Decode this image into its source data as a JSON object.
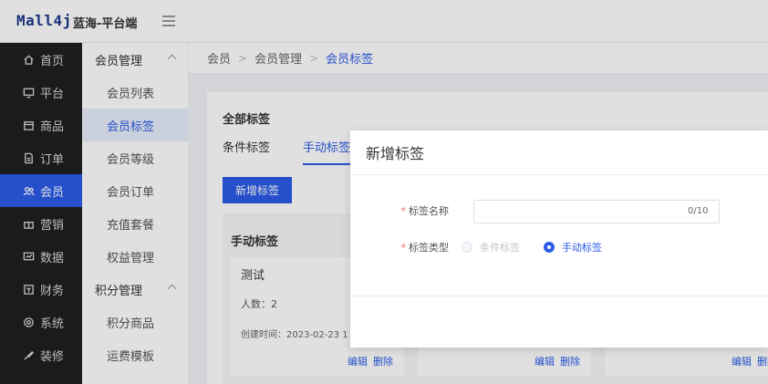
{
  "header": {
    "logo": "Mall4j",
    "brand": "蓝海-平台端"
  },
  "sidebar": {
    "items": [
      {
        "label": "首页",
        "icon": "home-icon"
      },
      {
        "label": "平台",
        "icon": "monitor-icon"
      },
      {
        "label": "商品",
        "icon": "box-icon"
      },
      {
        "label": "订单",
        "icon": "document-icon"
      },
      {
        "label": "会员",
        "icon": "users-icon"
      },
      {
        "label": "营销",
        "icon": "gift-icon"
      },
      {
        "label": "数据",
        "icon": "chart-icon"
      },
      {
        "label": "财务",
        "icon": "wallet-icon"
      },
      {
        "label": "系统",
        "icon": "gear-icon"
      },
      {
        "label": "装修",
        "icon": "brush-icon"
      }
    ]
  },
  "subnav": {
    "group1": "会员管理",
    "items1": [
      "会员列表",
      "会员标签",
      "会员等级",
      "会员订单",
      "充值套餐",
      "权益管理"
    ],
    "group2": "积分管理",
    "items2": [
      "积分商品",
      "运费模板"
    ]
  },
  "breadcrumb": [
    "会员",
    "会员管理",
    "会员标签"
  ],
  "content": {
    "title": "全部标签",
    "tabs": [
      "条件标签",
      "手动标签"
    ],
    "add_button": "新增标签",
    "group_title": "手动标签",
    "card": {
      "name": "测试",
      "count": "人数：2",
      "time": "创建时间：2023-02-23 1"
    },
    "edit": "编辑",
    "delete": "删除"
  },
  "modal": {
    "title": "新增标签",
    "name_label": "标签名称",
    "name_value": "",
    "name_count": "0/10",
    "type_label": "标签类型",
    "option_condition": "条件标签",
    "option_manual": "手动标签"
  },
  "colors": {
    "primary": "#2b5be7",
    "sidebar_bg": "#1f1f1f",
    "required": "#f56c6c"
  }
}
